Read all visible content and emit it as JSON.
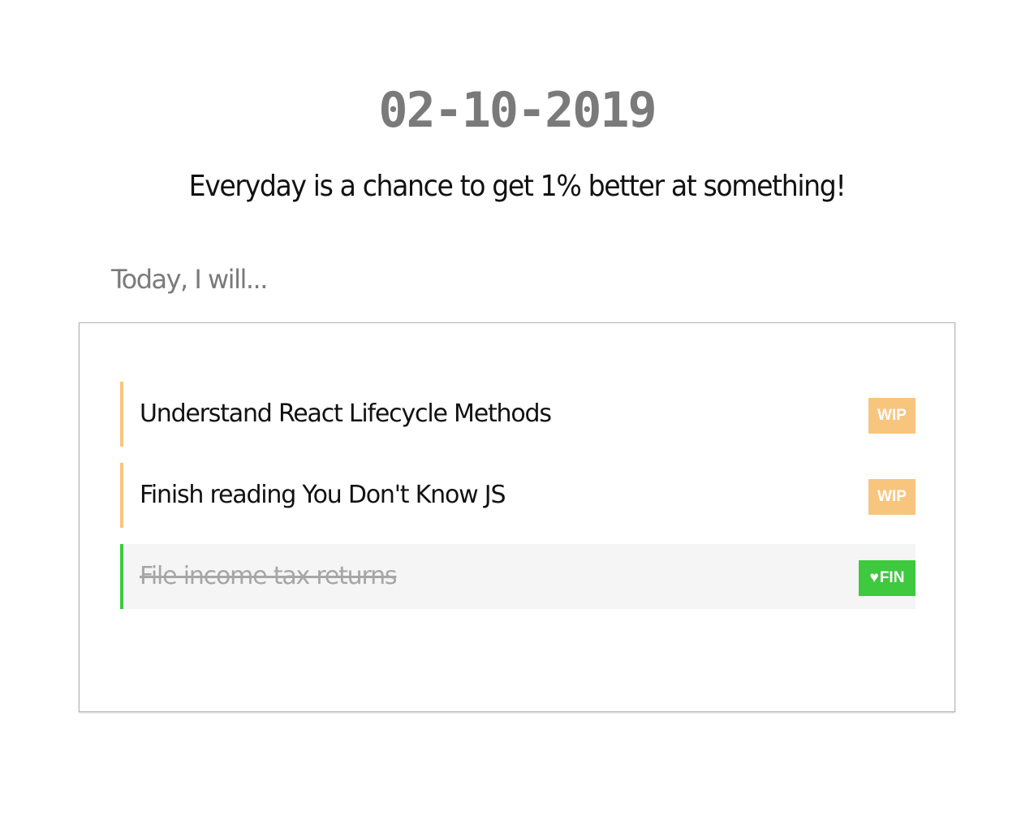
{
  "header": {
    "date": "02-10-2019",
    "motto": "Everyday is a chance to get 1% better at something!"
  },
  "prompt": "Today, I will...",
  "todos": [
    {
      "text": "Understand React Lifecycle Methods",
      "status": "WIP",
      "done": false
    },
    {
      "text": "Finish reading You Don't Know JS",
      "status": "WIP",
      "done": false
    },
    {
      "text": "File income tax returns",
      "status": "FIN",
      "done": true,
      "status_icon": "heart-icon"
    }
  ],
  "colors": {
    "wip_accent": "#f8c57f",
    "fin_accent": "#3ec93e",
    "done_row_bg": "#f5f5f5",
    "muted_text": "#7a7a7a"
  }
}
